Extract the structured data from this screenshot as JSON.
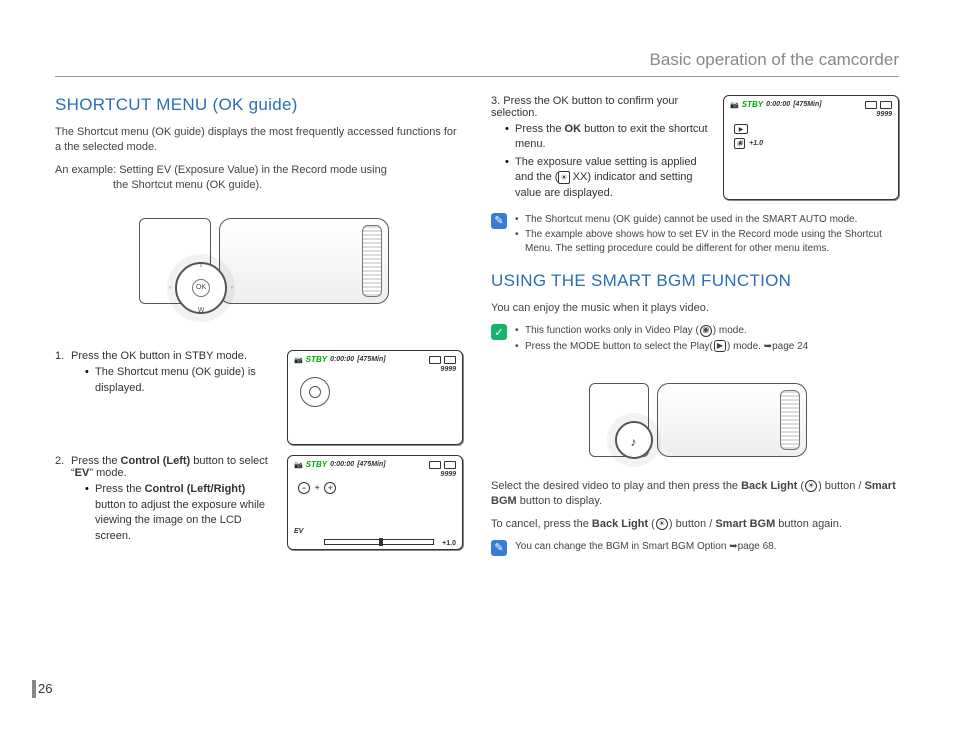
{
  "header": {
    "title": "Basic operation of the camcorder"
  },
  "page_number": "26",
  "left": {
    "section_title": "SHORTCUT MENU (OK guide)",
    "intro": "The Shortcut menu (OK guide) displays the most frequently accessed functions for a the selected mode.",
    "example_line1": "An example: Setting EV (Exposure Value) in the Record mode using",
    "example_line2": "the Shortcut menu (OK guide).",
    "camcorder": {
      "ok": "OK",
      "t": "T",
      "w": "W"
    },
    "steps": {
      "s1": "Press the OK button in STBY mode.",
      "s1_b1": "The Shortcut menu (OK guide) is displayed.",
      "s2_pre": "Press the ",
      "s2_bold": "Control (Left)",
      "s2_post": " button to select “",
      "s2_ev": "EV",
      "s2_end": "” mode.",
      "s2_b1_pre": "Press the ",
      "s2_b1_bold": "Control (Left/Right)",
      "s2_b1_post": " button to adjust the exposure while viewing the image on the LCD screen."
    },
    "lcd1": {
      "stby": "STBY",
      "time": "0:00:00",
      "res": "[475Min]",
      "counter": "9999"
    },
    "lcd2": {
      "stby": "STBY",
      "time": "0:00:00",
      "res": "[475Min]",
      "counter": "9999",
      "minus": "−",
      "ev_icon": "☀",
      "plus": "+",
      "ev_label": "EV",
      "ev_value": "+1.0"
    }
  },
  "right": {
    "step3": {
      "num": "3.",
      "text": "Press the OK button to confirm your selection.",
      "b1_pre": "Press the ",
      "b1_bold": "OK",
      "b1_post": " button to exit the shortcut menu.",
      "b2_pre": "The exposure value setting is applied and the (",
      "b2_icon": "☀",
      "b2_xx": "XX",
      "b2_post": ") indicator and setting value are displayed."
    },
    "lcd3": {
      "stby": "STBY",
      "time": "0:00:00",
      "res": "[475Min]",
      "counter": "9999",
      "rec": "▶",
      "ev_readout": "+1.0"
    },
    "note1": {
      "items": [
        "The Shortcut menu (OK guide) cannot be used in the SMART AUTO mode.",
        "The example above shows how to set EV in the Record mode using the Shortcut Menu. The setting procedure could be different for other menu items."
      ]
    },
    "section2_title": "USING THE SMART BGM FUNCTION",
    "section2_intro": "You can enjoy the music when it plays video.",
    "note2": {
      "i1_pre": "This function works only in Video Play (",
      "i1_post": ") mode.",
      "i2_pre": "Press the MODE button to select the Play(",
      "i2_post": ") mode. ",
      "i2_ref": "➥page 24"
    },
    "para2_pre": "Select the desired video to play and then press the ",
    "para2_bold": "Back Light",
    "para2_mid": " (",
    "para2_mid2": ") button / ",
    "para2_bold2": "Smart BGM",
    "para2_end": " button to display.",
    "para3_pre": "To cancel, press the ",
    "para3_bold": "Back Light",
    "para3_mid": " (",
    "para3_mid2": ") button / ",
    "para3_bold2": "Smart BGM",
    "para3_end": " button again.",
    "note3": {
      "text_pre": "You can change the BGM in Smart BGM Option ",
      "text_ref": "➥page 68."
    },
    "icons": {
      "video_play": "◉",
      "play": "▶",
      "backlight": "☀",
      "music": "♪"
    }
  }
}
